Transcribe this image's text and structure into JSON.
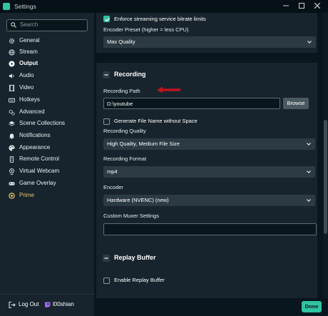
{
  "window": {
    "title": "Settings"
  },
  "sidebar": {
    "search_placeholder": "Search",
    "items": [
      {
        "label": "General",
        "icon": "gear-icon"
      },
      {
        "label": "Stream",
        "icon": "globe-icon"
      },
      {
        "label": "Output",
        "icon": "play-circle-icon",
        "active": true
      },
      {
        "label": "Audio",
        "icon": "speaker-icon"
      },
      {
        "label": "Video",
        "icon": "film-icon"
      },
      {
        "label": "Hotkeys",
        "icon": "keyboard-icon"
      },
      {
        "label": "Advanced",
        "icon": "gears-icon"
      },
      {
        "label": "Scene Collections",
        "icon": "layers-icon"
      },
      {
        "label": "Notifications",
        "icon": "bell-icon"
      },
      {
        "label": "Appearance",
        "icon": "palette-icon"
      },
      {
        "label": "Remote Control",
        "icon": "remote-icon"
      },
      {
        "label": "Virtual Webcam",
        "icon": "webcam-icon"
      },
      {
        "label": "Game Overlay",
        "icon": "gamepad-icon"
      },
      {
        "label": "Prime",
        "icon": "prime-icon"
      }
    ],
    "logout_label": "Log Out",
    "username": "l00shian"
  },
  "streaming": {
    "enforce_bitrate_label": "Enforce streaming service bitrate limits",
    "enforce_bitrate_checked": true,
    "encoder_preset_label": "Encoder Preset (higher = less CPU)",
    "encoder_preset_value": "Max Quality"
  },
  "recording": {
    "title": "Recording",
    "path_label": "Recording Path",
    "path_value": "D:\\youtube",
    "browse_label": "Browse",
    "gen_filename_label": "Generate File Name without Space",
    "gen_filename_checked": false,
    "quality_label": "Recording Quality",
    "quality_value": "High Quality, Medium File Size",
    "format_label": "Recording Format",
    "format_value": "mp4",
    "encoder_label": "Encoder",
    "encoder_value": "Hardware (NVENC) (new)",
    "muxer_label": "Custom Muxer Settings",
    "muxer_value": ""
  },
  "replay_buffer": {
    "title": "Replay Buffer",
    "enable_label": "Enable Replay Buffer",
    "enable_checked": false
  },
  "footer": {
    "done_label": "Done"
  },
  "colors": {
    "accent": "#31c3a2",
    "arrow": "#c0141c",
    "sidebar_bg": "#17242d",
    "page_bg": "#09161d",
    "prime": "#e9c46a"
  }
}
